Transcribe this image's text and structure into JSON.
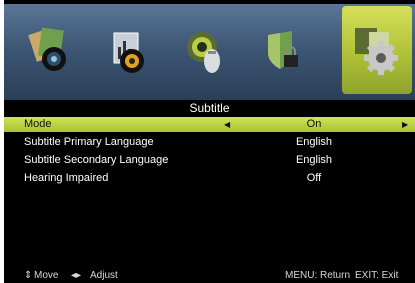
{
  "tabs": [
    {
      "icon": "picture-icon",
      "active": false
    },
    {
      "icon": "sound-icon",
      "active": false
    },
    {
      "icon": "channel-icon",
      "active": false
    },
    {
      "icon": "lock-icon",
      "active": false
    },
    {
      "icon": "settings-gear-icon",
      "active": true
    }
  ],
  "page_title": "Subtitle",
  "rows": [
    {
      "label": "Mode",
      "value": "On",
      "selected": true
    },
    {
      "label": "Subtitle Primary Language",
      "value": "English",
      "selected": false
    },
    {
      "label": "Subtitle Secondary Language",
      "value": "English",
      "selected": false
    },
    {
      "label": "Hearing Impaired",
      "value": "Off",
      "selected": false
    }
  ],
  "footer": {
    "move": "Move",
    "adjust": "Adjust",
    "menu": "MENU: Return",
    "exit": "EXIT: Exit"
  },
  "colors": {
    "highlight": "#b8cc3f",
    "background": "#000000",
    "topbar": "#3d5775"
  }
}
